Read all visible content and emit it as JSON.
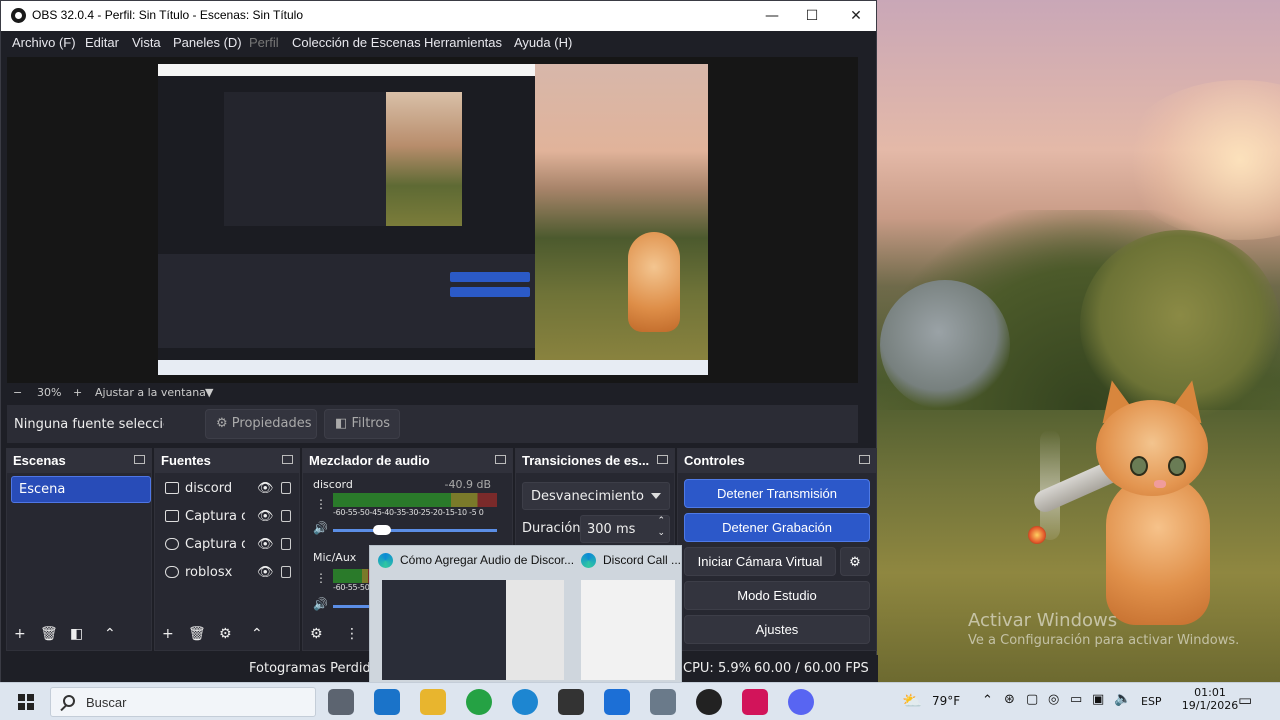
{
  "window": {
    "title": "OBS 32.0.4 - Perfil: Sin Título - Escenas: Sin Título",
    "minimize": "—",
    "maximize": "☐",
    "close": "✕"
  },
  "menu": {
    "items": [
      {
        "label": "Archivo (F)"
      },
      {
        "label": "Editar"
      },
      {
        "label": "Vista"
      },
      {
        "label": "Paneles (D)"
      },
      {
        "label": "Perfil"
      },
      {
        "label": "Colección de Escenas"
      },
      {
        "label": "Herramientas"
      },
      {
        "label": "Ayuda (H)"
      }
    ]
  },
  "zoom": {
    "minus": "−",
    "value": "30%",
    "plus": "+",
    "fit": "Ajustar a la ventana",
    "dropdown_glyph": "▼"
  },
  "source_bar": {
    "no_source": "Ninguna fuente seleccionac",
    "properties": "Propiedades",
    "filters": "Filtros"
  },
  "scenes": {
    "header": "Escenas",
    "items": [
      "Escena"
    ]
  },
  "sources": {
    "header": "Fuentes",
    "items": [
      {
        "label": "discord",
        "icon": "window-capture-icon"
      },
      {
        "label": "Captura de",
        "icon": "display-capture-icon"
      },
      {
        "label": "Captura de",
        "icon": "game-capture-icon"
      },
      {
        "label": "roblosx",
        "icon": "game-capture-icon"
      }
    ]
  },
  "mixer": {
    "header": "Mezclador de audio",
    "tracks": [
      {
        "name": "discord",
        "level": "-40.9 dB",
        "scale": "-60-55-50-45-40-35-30-25-20-15-10 -5  0"
      },
      {
        "name": "Mic/Aux",
        "level": "",
        "scale": "-60-55-50-45-4"
      }
    ]
  },
  "transitions": {
    "header": "Transiciones de es...",
    "selected": "Desvanecimiento",
    "duration_label": "Duración",
    "duration_value": "300 ms"
  },
  "controls": {
    "header": "Controles",
    "stop_stream": "Detener Transmisión",
    "stop_record": "Detener Grabación",
    "virtual_cam": "Iniciar Cámara Virtual",
    "studio": "Modo Estudio",
    "settings": "Ajustes"
  },
  "status": {
    "dropped": "Fotogramas Perdidos",
    "cpu": "CPU: 5.9%",
    "fps": "60.00 / 60.00 FPS"
  },
  "thumbnails": [
    {
      "title": "Cómo Agregar Audio de Discor..."
    },
    {
      "title": "Discord Call ..."
    }
  ],
  "desktop": {
    "activate_title": "Activar Windows",
    "activate_sub": "Ve a Configuración para activar Windows."
  },
  "taskbar": {
    "search": "Buscar",
    "weather": "79°F",
    "lang": "ESP",
    "time": "01:01",
    "date": "19/1/2026",
    "apps": [
      {
        "name": "task-view",
        "color": "#5c6470"
      },
      {
        "name": "outlook",
        "color": "#1a73c9"
      },
      {
        "name": "file-explorer",
        "color": "#e8b52e"
      },
      {
        "name": "whatsapp",
        "color": "#25a244"
      },
      {
        "name": "edge",
        "color": "#1d86d1"
      },
      {
        "name": "capcut",
        "color": "#333333"
      },
      {
        "name": "roblox",
        "color": "#1c6fd6"
      },
      {
        "name": "copilot",
        "color": "#6a7a8a"
      },
      {
        "name": "obs",
        "color": "#222222"
      },
      {
        "name": "bookmark-app",
        "color": "#d2145a"
      },
      {
        "name": "discord",
        "color": "#5865f2"
      }
    ]
  },
  "colors": {
    "accent": "#2c58c9",
    "panel_bg": "#272831",
    "header_bg": "#30313b"
  }
}
